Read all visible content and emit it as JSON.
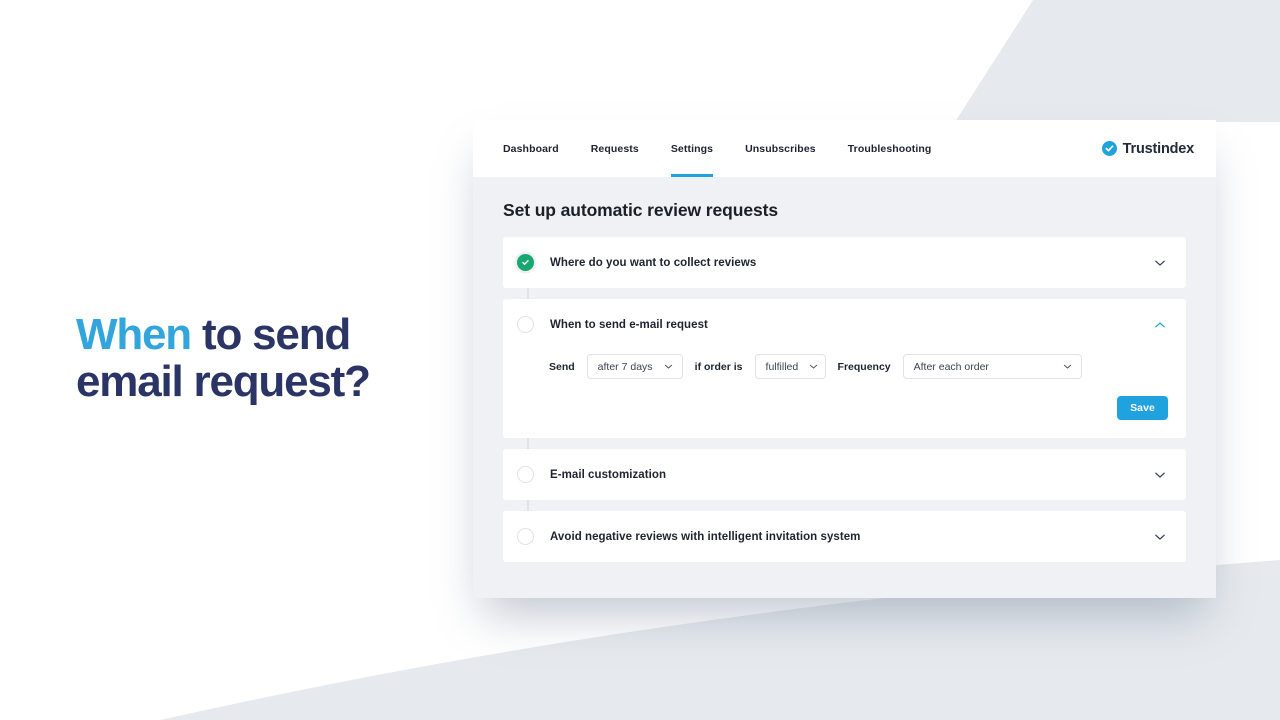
{
  "hero": {
    "accent_word": "When",
    "rest_line1": " to send",
    "line2": "email request?",
    "accent_color": "#32a5dd",
    "text_color": "#2a3566"
  },
  "brand": {
    "name": "Trustindex",
    "mark_icon": "check-badge-icon",
    "mark_color": "#1fa2dd"
  },
  "nav": {
    "tabs": [
      {
        "label": "Dashboard",
        "active": false
      },
      {
        "label": "Requests",
        "active": false
      },
      {
        "label": "Settings",
        "active": true
      },
      {
        "label": "Unsubscribes",
        "active": false
      },
      {
        "label": "Troubleshooting",
        "active": false
      }
    ],
    "active_indicator_color": "#1fa2dd"
  },
  "page": {
    "title": "Set up automatic review requests",
    "background": "#eff1f4"
  },
  "accordion": {
    "panels": [
      {
        "title": "Where do you want to collect reviews",
        "state": "completed",
        "expanded": false,
        "chevron": "chevron-down-icon",
        "dot_color": "#16a870"
      },
      {
        "title": "When to send e-mail request",
        "state": "current",
        "expanded": true,
        "chevron": "chevron-up-icon",
        "chevron_color": "#1fa2dd"
      },
      {
        "title": "E-mail customization",
        "state": "pending",
        "expanded": false,
        "chevron": "chevron-down-icon"
      },
      {
        "title": "Avoid negative reviews with intelligent invitation system",
        "state": "pending",
        "expanded": false,
        "chevron": "chevron-down-icon"
      }
    ]
  },
  "form": {
    "send_label": "Send",
    "send_value": "after 7 days",
    "order_label": "if order is",
    "order_value": "fulfilled",
    "frequency_label": "Frequency",
    "frequency_value": "After each order",
    "save_label": "Save",
    "save_color": "#1fa2dd"
  }
}
